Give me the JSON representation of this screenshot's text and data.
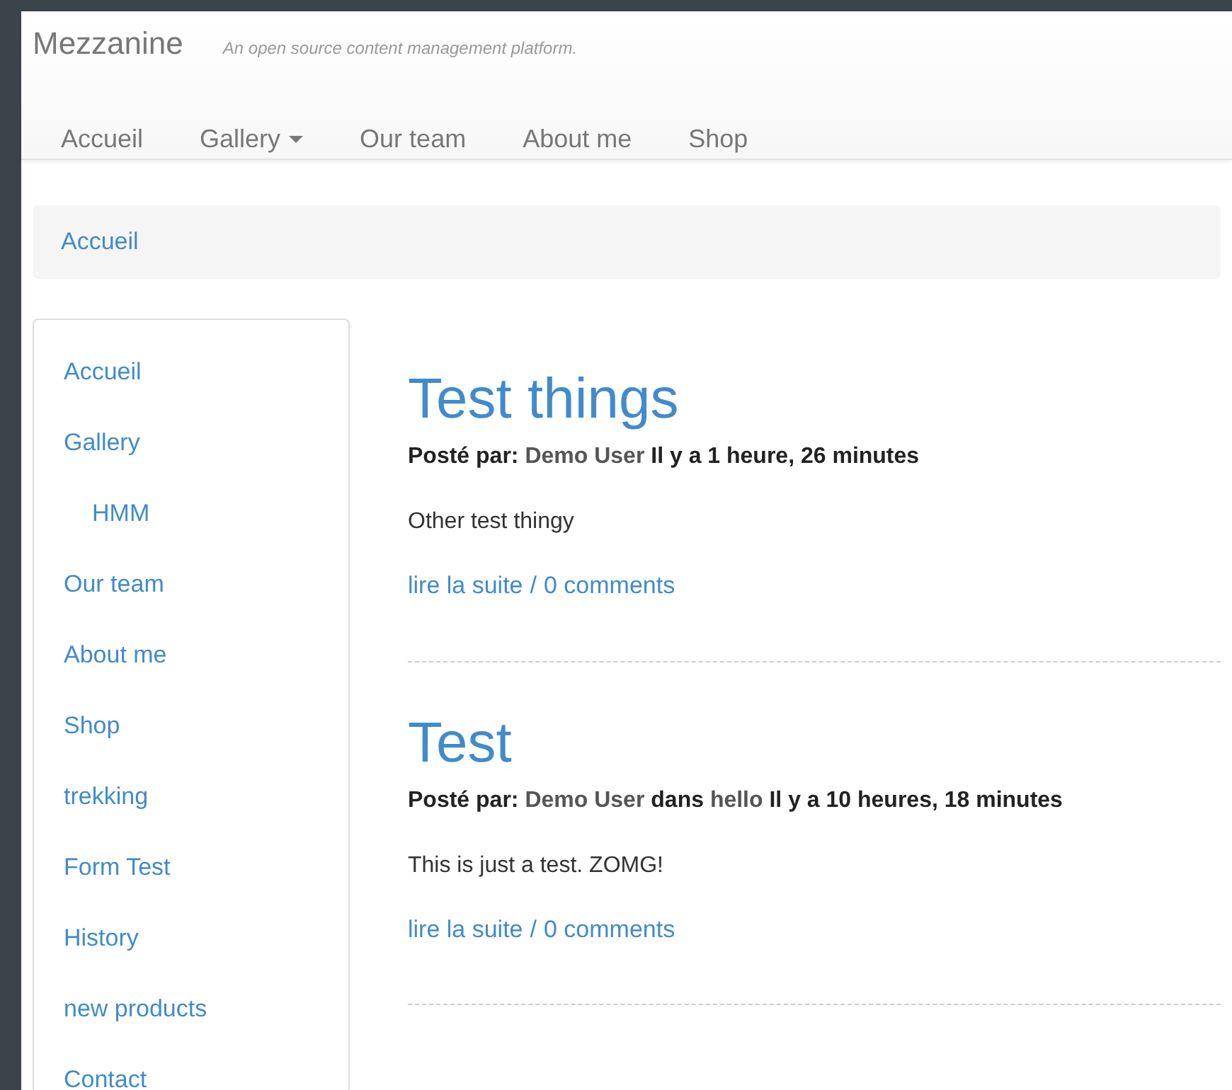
{
  "brand": {
    "name": "Mezzanine",
    "tagline": "An open source content management platform."
  },
  "nav": [
    {
      "label": "Accueil",
      "dropdown": false
    },
    {
      "label": "Gallery",
      "dropdown": true
    },
    {
      "label": "Our team",
      "dropdown": false
    },
    {
      "label": "About me",
      "dropdown": false
    },
    {
      "label": "Shop",
      "dropdown": false
    }
  ],
  "breadcrumb": [
    "Accueil"
  ],
  "sidebar": {
    "items": [
      {
        "label": "Accueil"
      },
      {
        "label": "Gallery",
        "children": [
          {
            "label": "HMM"
          }
        ]
      },
      {
        "label": "Our team"
      },
      {
        "label": "About me"
      },
      {
        "label": "Shop"
      },
      {
        "label": "trekking"
      },
      {
        "label": "Form Test"
      },
      {
        "label": "History"
      },
      {
        "label": "new products"
      },
      {
        "label": "Contact"
      }
    ]
  },
  "posts": [
    {
      "title": "Test things",
      "meta": [
        {
          "kind": "label",
          "text": "Posté par:"
        },
        {
          "kind": "link",
          "text": "Demo User"
        },
        {
          "kind": "text",
          "text": "Il y a 1 heure, 26 minutes"
        }
      ],
      "body": "Other test thingy",
      "read_more": "lire la suite",
      "separator": "/",
      "comments": "0 comments"
    },
    {
      "title": "Test",
      "meta": [
        {
          "kind": "label",
          "text": "Posté par:"
        },
        {
          "kind": "link",
          "text": "Demo User"
        },
        {
          "kind": "text",
          "text": "dans"
        },
        {
          "kind": "link",
          "text": "hello"
        },
        {
          "kind": "text",
          "text": "Il y a 10 heures, 18 minutes"
        }
      ],
      "body": "This is just a test. ZOMG!",
      "read_more": "lire la suite",
      "separator": "/",
      "comments": "0 comments"
    }
  ]
}
